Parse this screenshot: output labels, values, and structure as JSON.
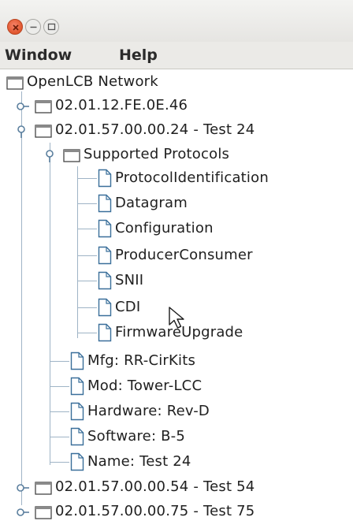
{
  "menubar": {
    "window": "Window",
    "help": "Help"
  },
  "tree": {
    "root": "OpenLCB Network",
    "node1": "02.01.12.FE.0E.46",
    "node2": "02.01.57.00.00.24 - Test 24",
    "protocols_folder": "Supported Protocols",
    "protocols": [
      "ProtocolIdentification",
      "Datagram",
      "Configuration",
      "ProducerConsumer",
      "SNII",
      "CDI",
      "FirmwareUpgrade"
    ],
    "details": [
      "Mfg: RR-CirKits",
      "Mod: Tower-LCC",
      "Hardware: Rev-D",
      "Software: B-5",
      "Name: Test 24"
    ],
    "node3": "02.01.57.00.00.54 - Test 54",
    "node4": "02.01.57.00.00.75 - Test 75"
  }
}
